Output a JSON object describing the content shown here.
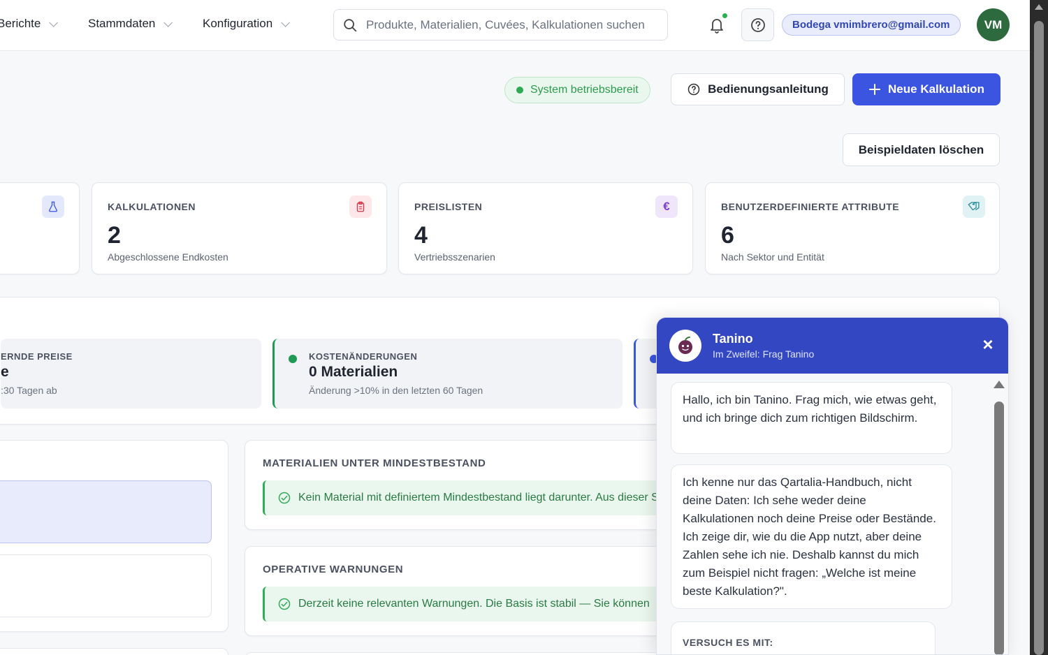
{
  "nav": {
    "items": [
      {
        "label": "Berichte"
      },
      {
        "label": "Stammdaten"
      },
      {
        "label": "Konfiguration"
      }
    ],
    "search_placeholder": "Produkte, Materialien, Cuvées, Kalkulationen suchen",
    "user_label": "Bodega vmimbrero@gmail.com",
    "avatar_initials": "VM"
  },
  "actions": {
    "status": "System betriebsbereit",
    "help_label": "Bedienungsanleitung",
    "new_label": "Neue Kalkulation",
    "delete_sample_label": "Beispieldaten löschen"
  },
  "stats": [
    {
      "label": "KALKULATIONEN",
      "value": "2",
      "sub": "Abgeschlossene Endkosten",
      "icon": "clipboard-icon"
    },
    {
      "label": "PREISLISTEN",
      "value": "4",
      "sub": "Vertriebsszenarien",
      "icon": "euro-icon"
    },
    {
      "label": "BENUTZERDEFINIERTE ATTRIBUTE",
      "value": "6",
      "sub": "Nach Sektor und Entität",
      "icon": "tag-icon"
    }
  ],
  "alerts": {
    "left": {
      "title": "ERNDE PREISE",
      "value": "e",
      "sub": ":30 Tagen ab"
    },
    "middle": {
      "title": "KOSTENÄNDERUNGEN",
      "value": "0 Materialien",
      "sub": "Änderung >10% in den letzten 60 Tagen"
    }
  },
  "sections": {
    "stock": {
      "title": "MATERIALIEN UNTER MINDESTBESTAND",
      "message": "Kein Material mit definiertem Mindestbestand liegt darunter. Aus dieser Sicht ist alles in Ordnung."
    },
    "warnings": {
      "title": "OPERATIVE WARNUNGEN",
      "message": "Derzeit keine relevanten Warnungen. Die Basis ist stabil — Sie können"
    }
  },
  "chat": {
    "name": "Tanino",
    "tagline": "Im Zweifel: Frag Tanino",
    "close": "×",
    "messages": [
      "Hallo, ich bin Tanino. Frag mich, wie etwas geht, und ich bringe dich zum richtigen Bildschirm.",
      "Ich kenne nur das Qartalia-Handbuch, nicht deine Daten: Ich sehe weder deine Kalkulationen noch deine Preise oder Bestände. Ich zeige dir, wie du die App nutzt, aber deine Zahlen sehe ich nie. Deshalb kannst du mich zum Beispiel nicht fragen: „Welche ist meine beste Kalkulation?\"."
    ],
    "try_label": "VERSUCH ES MIT:"
  },
  "colors": {
    "primary": "#3b55e0",
    "chat_header": "#3347c2",
    "success": "#2eaa55",
    "avatar": "#2d6a3e"
  }
}
